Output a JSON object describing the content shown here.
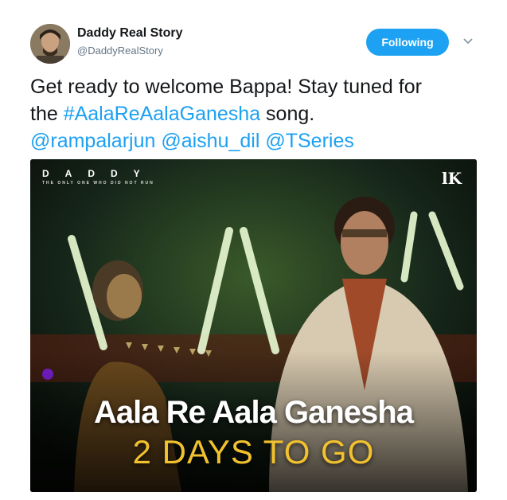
{
  "author": {
    "display_name": "Daddy Real Story",
    "handle": "@DaddyRealStory",
    "avatar_icon": "profile-photo"
  },
  "follow_button": {
    "label": "Following",
    "color": "#1da1f2"
  },
  "tweet": {
    "line1": "Get ready to welcome Bappa! Stay tuned for",
    "line2_prefix": "the ",
    "hashtag": "#AalaReAalaGanesha",
    "line2_suffix": " song.",
    "mention1": "@rampalarjun",
    "mention2": "@aishu_dil",
    "mention3": "@TSeries"
  },
  "media": {
    "brand_title": "DADDY",
    "brand_tagline": "THE ONLY ONE WHO DID NOT RUN",
    "logo_text": "lK",
    "title": "Aala Re Aala Ganesha",
    "subtitle": "2 DAYS TO GO",
    "accent_color": "#f2c12e"
  }
}
